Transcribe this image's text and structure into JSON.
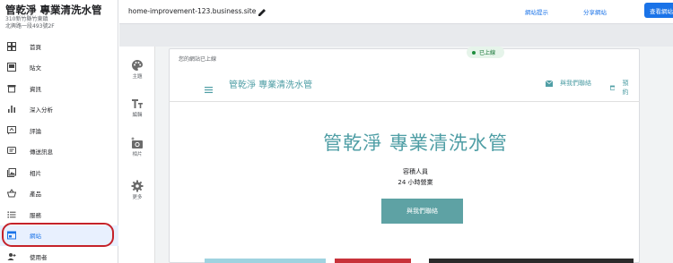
{
  "business": {
    "name": "管乾淨 專業清洗水管",
    "address_line1": "310新竹縣竹東鎮",
    "address_line2": "北興路一段493號2F"
  },
  "sidebar": {
    "items": [
      {
        "label": "首頁",
        "icon": "home-grid-icon"
      },
      {
        "label": "貼文",
        "icon": "posts-icon"
      },
      {
        "label": "資訊",
        "icon": "storefront-icon"
      },
      {
        "label": "深入分析",
        "icon": "insights-bar-icon"
      },
      {
        "label": "評論",
        "icon": "reviews-icon"
      },
      {
        "label": "傳送訊息",
        "icon": "messages-icon"
      },
      {
        "label": "相片",
        "icon": "photos-icon"
      },
      {
        "label": "產品",
        "icon": "products-basket-icon"
      },
      {
        "label": "服務",
        "icon": "services-list-icon"
      },
      {
        "label": "網站",
        "icon": "website-icon",
        "active": true
      },
      {
        "label": "使用者",
        "icon": "add-user-icon"
      }
    ]
  },
  "topbar": {
    "url": "home-improvement-123.business.site",
    "tips_label": "網站提示",
    "share_label": "分享網站",
    "view_label": "查看網站"
  },
  "tools": {
    "theme": "主題",
    "edit": "編輯",
    "photos": "相片",
    "more": "更多"
  },
  "preview": {
    "status": "您的網站已上線",
    "live_badge": "已上線",
    "site_name": "管乾淨 專業清洗水管",
    "contact": "與我們聯絡",
    "book": "預約",
    "hero_title": "管乾淨 專業清洗水管",
    "hero_sub1": "容積人員",
    "hero_sub2": "24 小時營業",
    "cta": "與我們聯絡"
  },
  "colors": {
    "accent": "#1a73e8",
    "teal": "#4f9ea5",
    "highlight": "#c5222a",
    "live_green": "#1e8e3e"
  }
}
